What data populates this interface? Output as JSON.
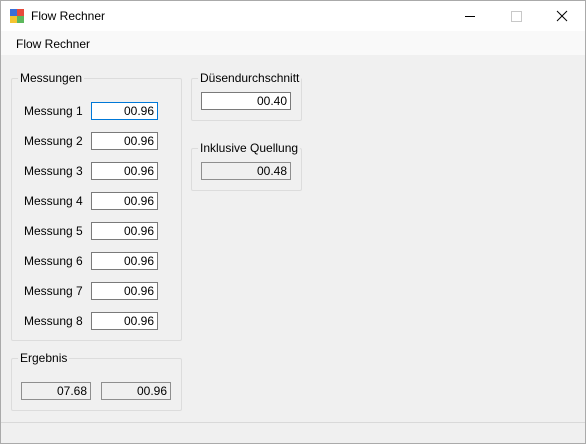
{
  "window": {
    "title": "Flow Rechner"
  },
  "menu": {
    "items": [
      {
        "label": "Flow Rechner"
      }
    ]
  },
  "messungen": {
    "title": "Messungen",
    "rows": [
      {
        "label": "Messung 1",
        "value": "00.96"
      },
      {
        "label": "Messung 2",
        "value": "00.96"
      },
      {
        "label": "Messung 3",
        "value": "00.96"
      },
      {
        "label": "Messung 4",
        "value": "00.96"
      },
      {
        "label": "Messung 5",
        "value": "00.96"
      },
      {
        "label": "Messung 6",
        "value": "00.96"
      },
      {
        "label": "Messung 7",
        "value": "00.96"
      },
      {
        "label": "Messung 8",
        "value": "00.96"
      }
    ]
  },
  "ergebnis": {
    "title": "Ergebnis",
    "value_1": "07.68",
    "value_2": "00.96"
  },
  "duesendurchschnitt": {
    "title": "Düsendurchschnitt",
    "value": "00.40"
  },
  "inklusive_quellung": {
    "title": "Inklusive Quellung",
    "value": "00.48"
  }
}
